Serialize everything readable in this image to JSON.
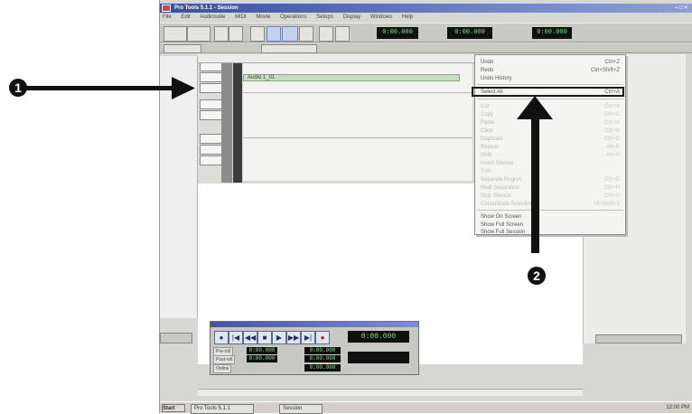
{
  "window": {
    "title": "Pro Tools 5.1.1 - Session",
    "controls": "– □ ×"
  },
  "menubar": [
    "File",
    "Edit",
    "Audiosuite",
    "MIDI",
    "Movie",
    "Operations",
    "Setups",
    "Display",
    "Windows",
    "Help"
  ],
  "toolbar": {
    "main_counter": "0:00.000",
    "start": "0:00.000",
    "end": "0:00.000",
    "length": "0:00.000",
    "cursor": "0:00.000"
  },
  "edit_window": {
    "region_name": "Audio 1_01"
  },
  "menu": {
    "items": [
      {
        "label": "Undo",
        "shortcut": "Ctrl+Z",
        "enabled": true
      },
      {
        "label": "Redo",
        "shortcut": "Ctrl+Shift+Z",
        "enabled": true
      },
      {
        "label": "Undo History",
        "shortcut": "",
        "enabled": true
      },
      {
        "label": "Select All",
        "shortcut": "Ctrl+A",
        "enabled": true,
        "highlighted": true
      },
      {
        "label": "Cut",
        "shortcut": "Ctrl+X",
        "enabled": false
      },
      {
        "label": "Copy",
        "shortcut": "Ctrl+C",
        "enabled": false
      },
      {
        "label": "Paste",
        "shortcut": "Ctrl+V",
        "enabled": false
      },
      {
        "label": "Clear",
        "shortcut": "Ctrl+B",
        "enabled": false
      },
      {
        "label": "Duplicate",
        "shortcut": "Ctrl+D",
        "enabled": false
      },
      {
        "label": "Repeat",
        "shortcut": "Alt+R",
        "enabled": false
      },
      {
        "label": "Shift",
        "shortcut": "Alt+H",
        "enabled": false
      },
      {
        "label": "Insert Silence",
        "shortcut": "",
        "enabled": false
      },
      {
        "label": "Trim",
        "shortcut": "",
        "enabled": false
      },
      {
        "label": "Separate Region",
        "shortcut": "Ctrl+E",
        "enabled": false
      },
      {
        "label": "Heal Separation",
        "shortcut": "Ctrl+H",
        "enabled": false
      },
      {
        "label": "Strip Silence",
        "shortcut": "Ctrl+U",
        "enabled": false
      },
      {
        "label": "Consolidate Selection",
        "shortcut": "Alt+Shift+3",
        "enabled": false
      },
      {
        "label": "Show On Screen",
        "shortcut": "",
        "enabled": true
      },
      {
        "label": "Show Full Screen",
        "shortcut": "",
        "enabled": true
      },
      {
        "label": "Show Full Session",
        "shortcut": "",
        "enabled": true
      }
    ]
  },
  "transport": {
    "counter_main": "0:00.000",
    "pre_roll": "0:00.000",
    "post_roll": "0:00.000",
    "start": "0:00.000",
    "end": "0:00.000",
    "length": "0:00.000",
    "label_pre": "Pre-roll",
    "label_post": "Post-roll",
    "label_mode": "Online"
  },
  "taskbar": {
    "start": "Start",
    "task1": "Pro Tools 5.1.1",
    "task2": "Session",
    "tray": "12:00 PM"
  },
  "callouts": [
    "1",
    "2"
  ],
  "icons": [
    "play-icon",
    "stop-icon",
    "record-icon",
    "rewind-icon",
    "fast-forward-icon",
    "return-to-zero-icon",
    "go-to-end-icon",
    "online-icon"
  ]
}
